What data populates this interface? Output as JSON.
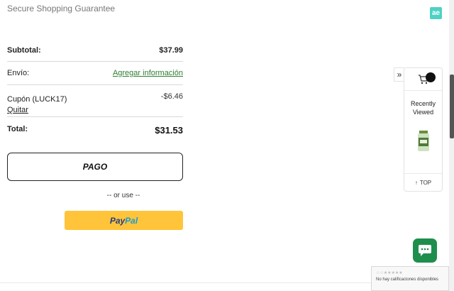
{
  "header": {
    "secure_text": "Secure Shopping Guarantee",
    "badge_text": "ae"
  },
  "summary": {
    "subtotal_label": "Subtotal:",
    "subtotal_value": "$37.99",
    "shipping_label": "Envío:",
    "shipping_link": "Agregar información",
    "coupon_label": "Cupón (LUCK17)",
    "coupon_remove": "Quitar",
    "coupon_value": "-$6.46",
    "total_label": "Total:",
    "total_value": "$31.53"
  },
  "actions": {
    "checkout_label": "PAGO",
    "or_use": "-- or use --",
    "paypal_pay": "Pay",
    "paypal_pal": "Pal"
  },
  "side_panel": {
    "toggle_glyph": "»",
    "recently_viewed": "Recently Viewed",
    "top_label": "TOP",
    "top_glyph": "↑"
  },
  "reviews": {
    "stars": "☆☆★★★★★",
    "no_reviews": "No hay calificaciones disponibles"
  },
  "colors": {
    "link_green": "#2e7d32",
    "paypal_yellow": "#ffc439",
    "chat_green": "#1e8e4d",
    "badge_teal": "#4fd1c5"
  }
}
